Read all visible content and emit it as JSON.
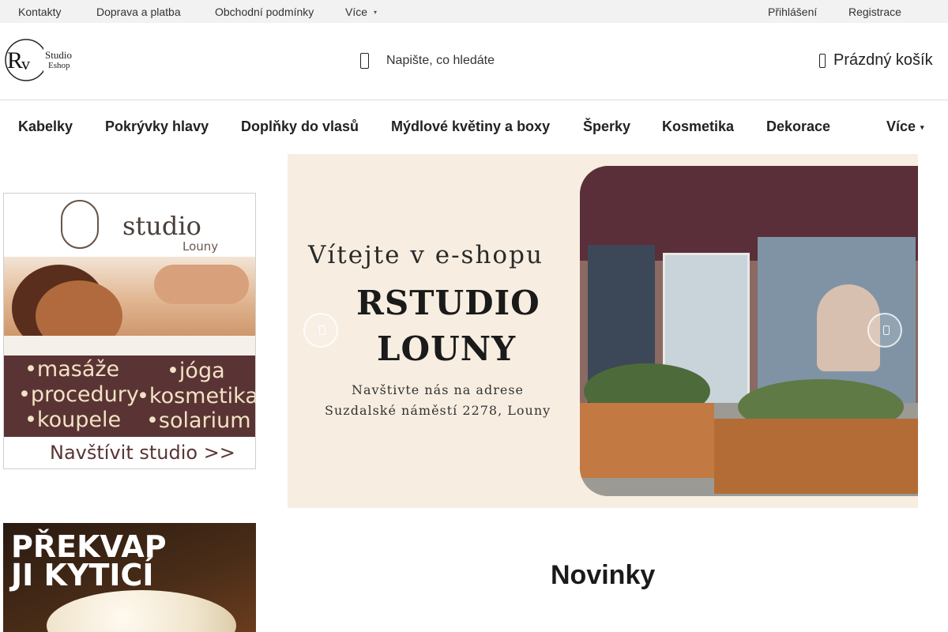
{
  "topbar": {
    "links": [
      "Kontakty",
      "Doprava a platba",
      "Obchodní podmínky"
    ],
    "more_label": "Více",
    "login_label": "Přihlášení",
    "register_label": "Registrace"
  },
  "header": {
    "logo_line1": "Studio",
    "logo_line2": "Eshop",
    "search_placeholder": "Napište, co hledáte",
    "cart_label": "Prázdný košík"
  },
  "categories": {
    "items": [
      "Kabelky",
      "Pokrývky hlavy",
      "Doplňky do vlasů",
      "Mýdlové květiny a boxy",
      "Šperky",
      "Kosmetika",
      "Dekorace"
    ],
    "more_label": "Více"
  },
  "promo_studio": {
    "brand_word": "studio",
    "brand_sub": "Louny",
    "services": [
      "•masáže",
      "•jóga",
      "•procedury",
      "•kosmetika",
      "•koupele",
      "•solarium"
    ],
    "cta": "Navštívit studio >>"
  },
  "promo_flowers": {
    "title_line1": "PŘEKVAP",
    "title_line2": "JI KYTICÍ"
  },
  "hero": {
    "welcome": "Vítejte v e-shopu",
    "brand_line1": "RSTUDIO",
    "brand_line2": "LOUNY",
    "visit": "Navštivte nás na adrese",
    "address": "Suzdalské náměstí 2278, Louny"
  },
  "sections": {
    "new_items_title": "Novinky"
  },
  "colors": {
    "topbar_bg": "#f2f2f2",
    "promo_band": "#5a3434",
    "promo_text": "#f2e2c4",
    "hero_bg": "#f7eee1"
  }
}
